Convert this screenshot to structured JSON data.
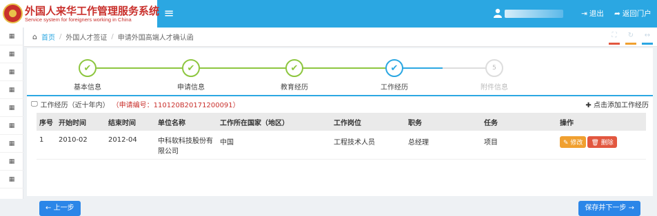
{
  "header": {
    "title_cn": "外国人来华工作管理服务系统",
    "title_en": "Service system for foreigners working in China",
    "menu_icon": "hamburger-icon",
    "logout_label": "退出",
    "portal_label": "返回门户"
  },
  "colors": {
    "primary": "#2ba7e2",
    "brand_red": "#c9302c",
    "step_done": "#8dc63f",
    "step_active": "#2ba7e2",
    "step_pending": "#cccccc",
    "button_blue": "#2b86e8",
    "edit_orange": "#f0a030",
    "delete_red": "#e2573f"
  },
  "breadcrumb": {
    "home": "首页",
    "items": [
      "外国人才签证",
      "申请外国高端人才确认函"
    ]
  },
  "steps": [
    {
      "label": "基本信息",
      "state": "done"
    },
    {
      "label": "申请信息",
      "state": "done"
    },
    {
      "label": "教育经历",
      "state": "done"
    },
    {
      "label": "工作经历",
      "state": "active"
    },
    {
      "label": "附件信息",
      "state": "pending",
      "number": "5"
    }
  ],
  "section": {
    "title": "工作经历（近十年内）",
    "app_no": "（申请编号：110120B20171200091）",
    "add_label": "点击添加工作经历"
  },
  "table": {
    "columns": [
      "序号",
      "开始时间",
      "结束时间",
      "单位名称",
      "工作所在国家（地区）",
      "工作岗位",
      "职务",
      "任务",
      "操作"
    ],
    "rows": [
      {
        "index": "1",
        "start": "2010-02",
        "end": "2012-04",
        "org_line1": "中科软科技股份有",
        "org_line2": "限公司",
        "country": "中国",
        "position": "工程技术人员",
        "title": "总经理",
        "task": "项目",
        "edit_label": "修改",
        "delete_label": "删除"
      }
    ]
  },
  "footer": {
    "prev_label": "上一步",
    "next_label": "保存并下一步"
  }
}
